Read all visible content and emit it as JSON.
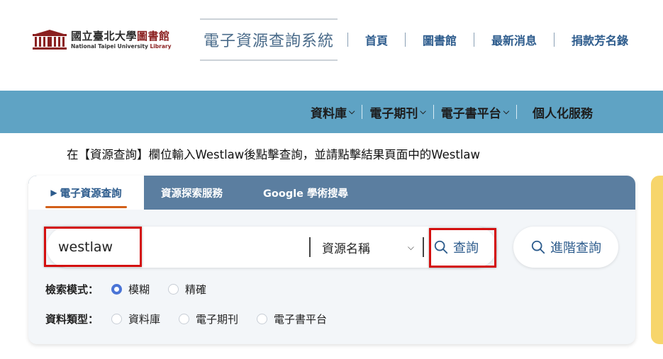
{
  "header": {
    "logo_cn_main": "國立臺北大學",
    "logo_cn_lib": "圖書館",
    "logo_en_main": "National Taipei University ",
    "logo_en_lib": "Library",
    "system_title": "電子資源查詢系統",
    "top_nav": [
      "首頁",
      "圖書館",
      "最新消息",
      "捐款芳名錄"
    ]
  },
  "main_nav": {
    "items": [
      {
        "label": "資料庫",
        "has_dropdown": true
      },
      {
        "label": "電子期刊",
        "has_dropdown": true
      },
      {
        "label": "電子書平台",
        "has_dropdown": true
      },
      {
        "label": "個人化服務",
        "has_dropdown": false
      }
    ]
  },
  "instruction": "在【資源查詢】欄位輸入Westlaw後點擊查詢，並請點擊結果頁面中的Westlaw",
  "search": {
    "tabs": [
      "電子資源查詢",
      "資源探索服務",
      "Google 學術搜尋"
    ],
    "active_tab_marker": "▶",
    "input_value": "westlaw",
    "field_select": "資源名稱",
    "search_button": "查詢",
    "advanced_button": "進階查詢",
    "mode_label": "檢索模式：",
    "modes": [
      "模糊",
      "精確"
    ],
    "selected_mode": "模糊",
    "type_label": "資料類型：",
    "types": [
      "資料庫",
      "電子期刊",
      "電子書平台"
    ]
  },
  "colors": {
    "nav_bar": "#5fa3c4",
    "tab_bar": "#5b7ea0",
    "accent_blue": "#2c5b8c",
    "active_underline": "#d2601a",
    "highlight_red": "#d40f0f",
    "radio_on": "#4a74d6",
    "side_card": "#f7d56b"
  }
}
